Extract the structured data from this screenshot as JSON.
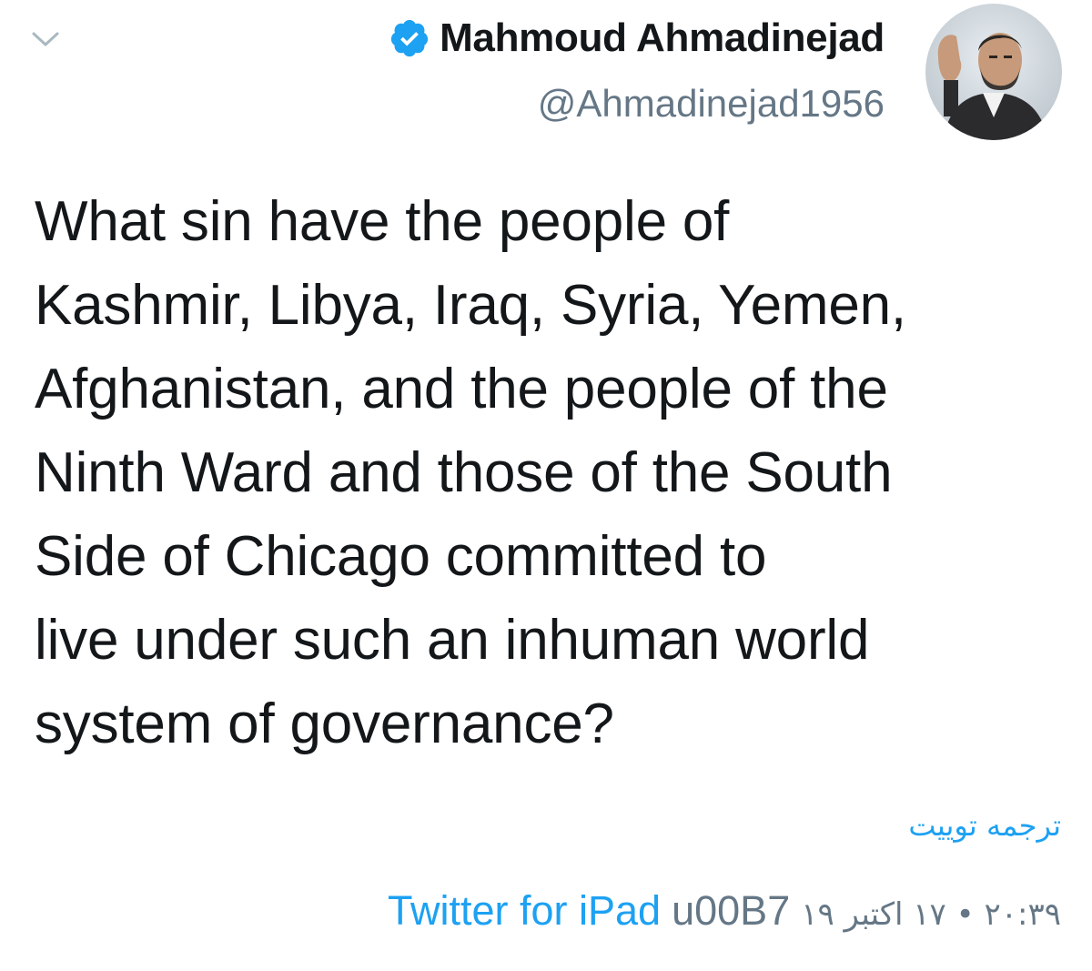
{
  "header": {
    "display_name": "Mahmoud Ahmadinejad",
    "handle": "@Ahmadinejad1956",
    "verified": true,
    "chevron_icon": "chevron-down-icon"
  },
  "tweet": {
    "lines": [
      "What sin have the people of",
      "Kashmir, Libya, Iraq, Syria, Yemen,",
      "Afghanistan, and the people of the",
      "Ninth Ward and those of the South",
      "Side of Chicago committed to",
      "live under such an inhuman world",
      "system of governance?"
    ],
    "translate_label": "ترجمه توییت",
    "source": "Twitter for iPad",
    "separator": "u00B7",
    "timestamp": "۲۰:۳۹ • ۱۷ اکتبر ۱۹"
  },
  "colors": {
    "link": "#1da1f2",
    "muted": "#657786",
    "text": "#14171a"
  }
}
